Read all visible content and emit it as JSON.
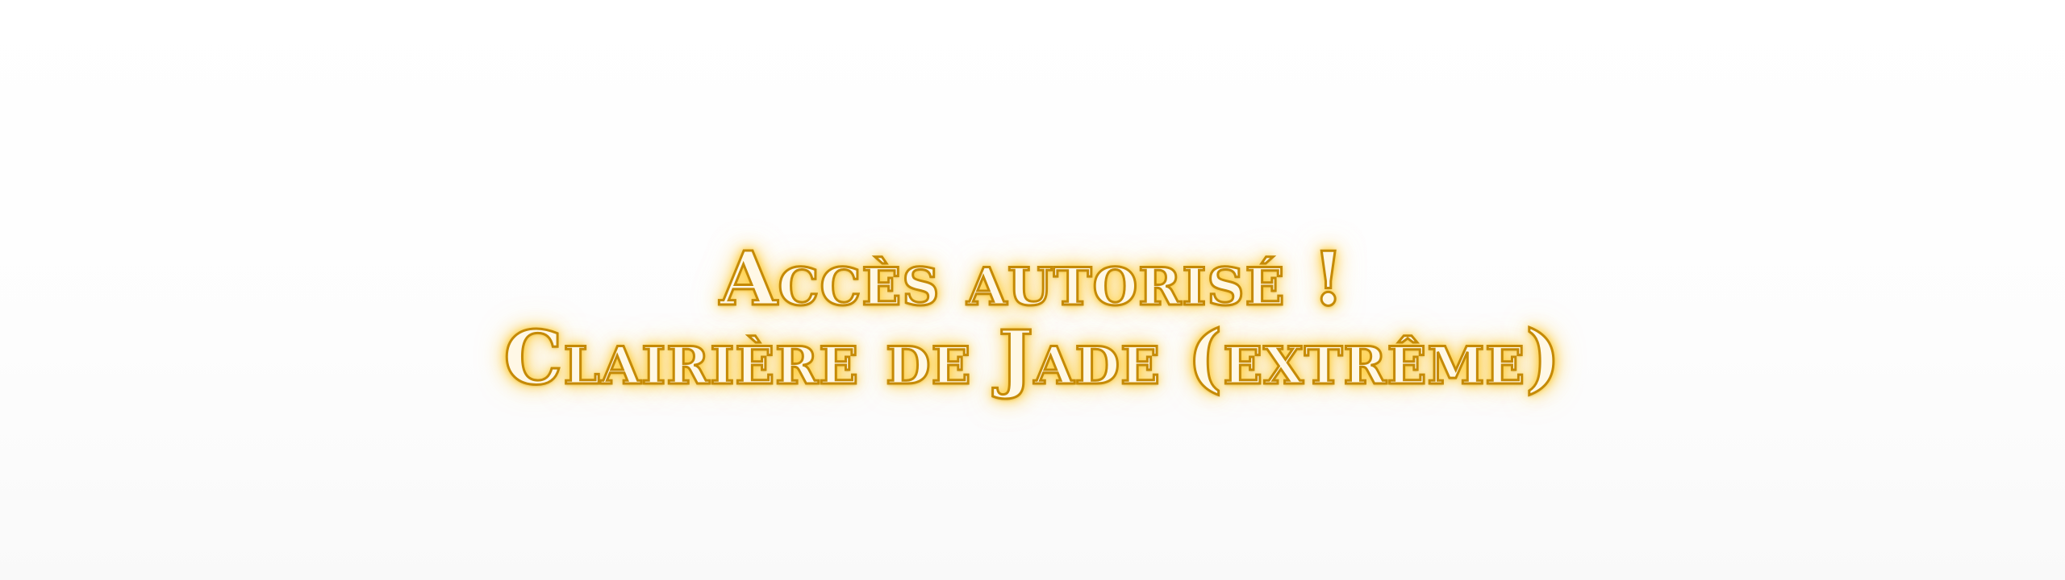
{
  "notification": {
    "line1": "Accès autorisé !",
    "line2": "Clairière de Jade (extrême)"
  },
  "colors": {
    "text_fill": "#fff8e6",
    "text_outline": "#c58a06",
    "glow": "#ffcc33",
    "background": "#fdfdfd"
  }
}
